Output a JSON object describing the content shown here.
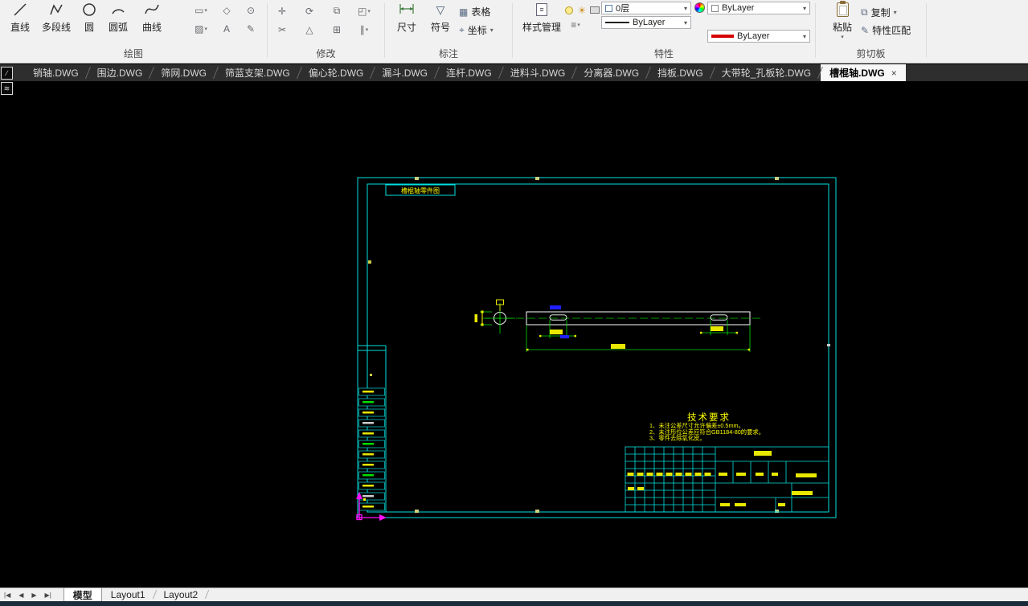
{
  "ribbon": {
    "draw": {
      "label": "绘图",
      "buttons": {
        "line": "直线",
        "polyline": "多段线",
        "circle": "圆",
        "arc": "圆弧",
        "spline": "曲线"
      }
    },
    "modify": {
      "label": "修改"
    },
    "annotate": {
      "label": "标注",
      "dim": "尺寸",
      "symbol": "符号",
      "table": "表格",
      "coord": "坐标"
    },
    "properties": {
      "label": "特性",
      "style_manager": "样式管理",
      "layer_value": "0层",
      "color_value": "ByLayer",
      "linetype_value": "ByLayer",
      "linecolor_value": "ByLayer"
    },
    "clipboard": {
      "label": "剪切板",
      "paste": "粘贴",
      "copy": "复制",
      "match_props": "特性匹配"
    }
  },
  "icons": {
    "rect_tool": "▭",
    "polygon_tool": "◇",
    "point_tool": "⊙",
    "hatch_tool": "▨",
    "text_tool": "A",
    "sketch_tool": "✎",
    "move": "✛",
    "rotate": "⟳",
    "copy_obj": "⧉",
    "scale": "◰",
    "trim": "✂",
    "mirror": "△",
    "array": "⊞",
    "offset": "∥",
    "table": "▦",
    "coord": "⌖",
    "symbol": "▽",
    "menu": "≡",
    "arrow": "▾",
    "copy": "⧉",
    "brush": "✎",
    "sun": "☀",
    "doc_lines": "≡",
    "nav_first": "|◀",
    "nav_prev": "◀",
    "nav_next": "▶",
    "nav_last": "▶|"
  },
  "doc_tabs": {
    "close_glyph": "×",
    "items": [
      {
        "label": "销轴.DWG"
      },
      {
        "label": "围边.DWG"
      },
      {
        "label": "筛网.DWG"
      },
      {
        "label": "筛蓝支架.DWG"
      },
      {
        "label": "偏心轮.DWG"
      },
      {
        "label": "漏斗.DWG"
      },
      {
        "label": "连杆.DWG"
      },
      {
        "label": "进料斗.DWG"
      },
      {
        "label": "分离器.DWG"
      },
      {
        "label": "挡板.DWG"
      },
      {
        "label": "大带轮_孔板轮.DWG"
      },
      {
        "label": "槽棍轴.DWG"
      }
    ]
  },
  "drawing": {
    "corner_label": "槽棍轴零件图",
    "tech_requirements": {
      "title": "技术要求",
      "lines": [
        "1、未注公差尺寸允许偏差±0.5mm。",
        "2、未注形位公差应符合GB1184-80的要求。",
        "3、零件去除氧化皮。"
      ]
    },
    "colors": {
      "frame": "#00e0e0",
      "geometry": "#ffffff",
      "dimension": "#00dd00",
      "text": "#ffff00",
      "note": "#2020ff",
      "ucs": "#ff10ff"
    }
  },
  "layout_bar": {
    "tabs": [
      {
        "label": "模型"
      },
      {
        "label": "Layout1"
      },
      {
        "label": "Layout2"
      }
    ]
  }
}
